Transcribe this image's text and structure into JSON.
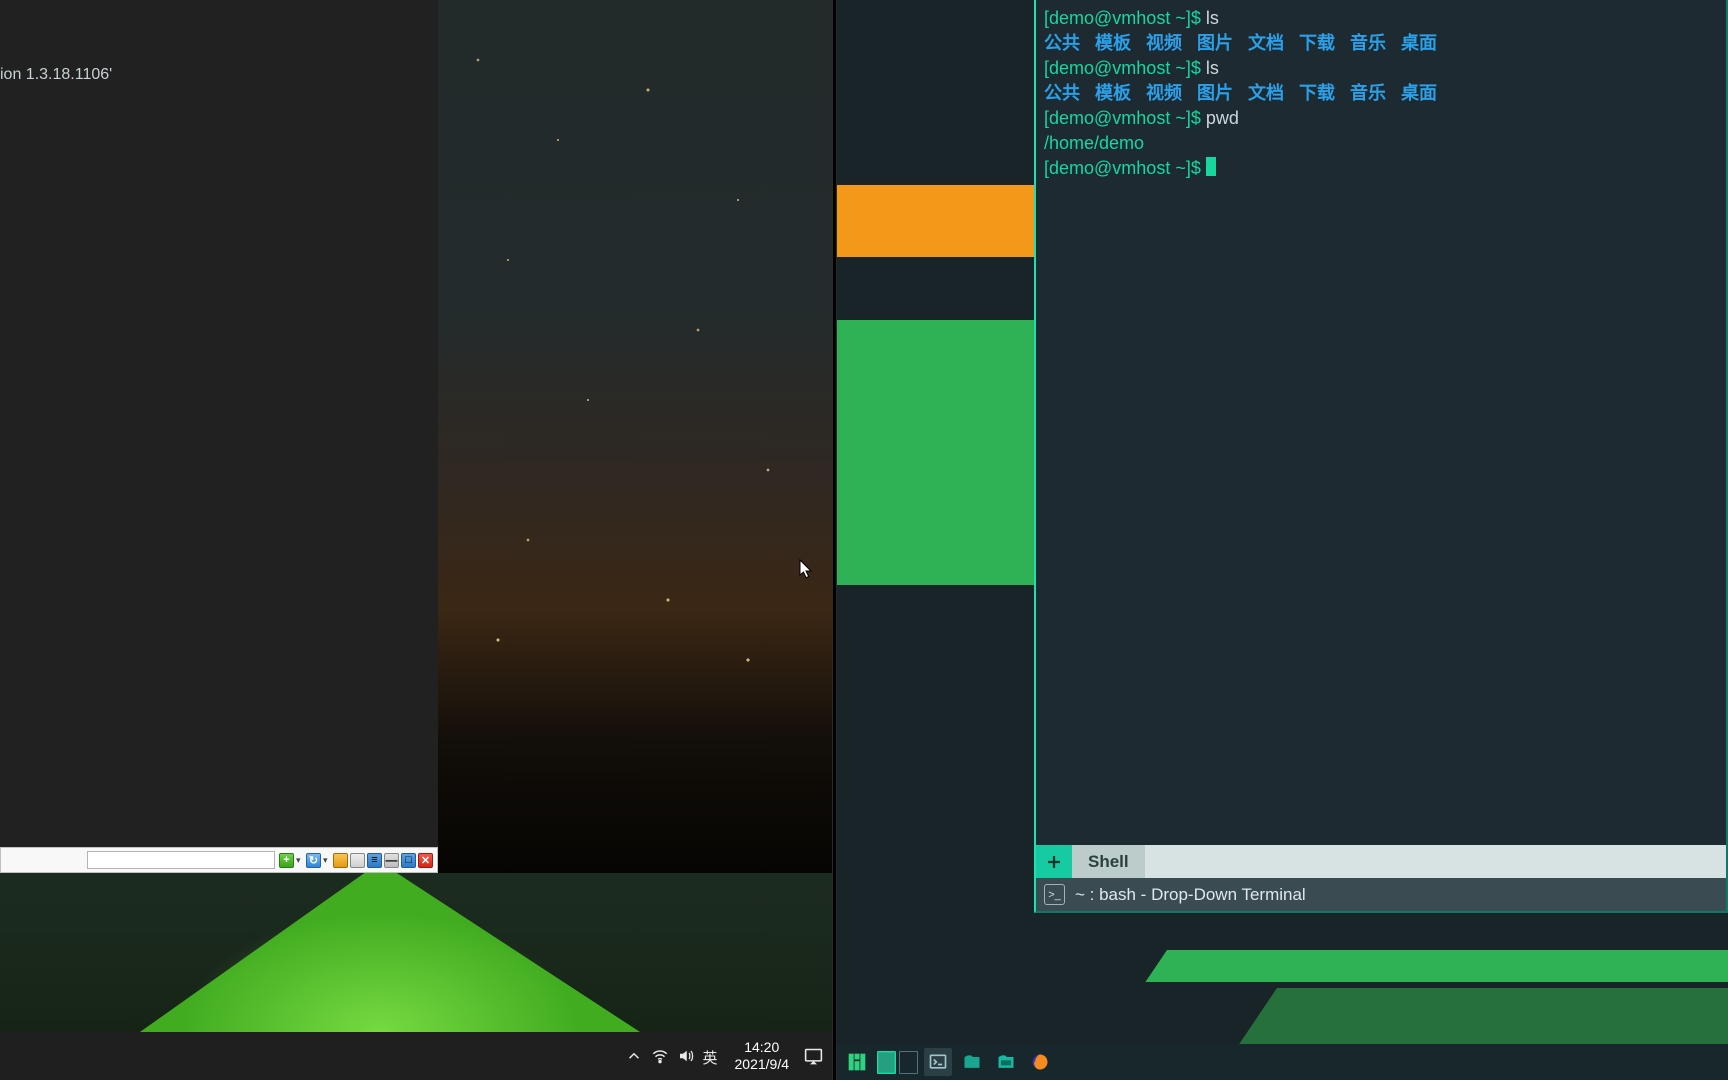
{
  "left_terminal": {
    "fragment": "ion 1.3.18.1106'"
  },
  "vnc_toolbar": {
    "icons": {
      "plus": "+",
      "refresh": "↻",
      "lock": "🔒",
      "screen": "▭",
      "list": "≡",
      "min": "—",
      "max": "□",
      "close": "✕"
    }
  },
  "windows_taskbar": {
    "ime": "英",
    "time": "14:20",
    "date": "2021/9/4"
  },
  "dropdown_terminal": {
    "prompt": "[demo@vmhost ~]$ ",
    "lines": [
      {
        "cmd": "ls"
      },
      {
        "dirs": [
          "公共",
          "模板",
          "视频",
          "图片",
          "文档",
          "下载",
          "音乐",
          "桌面"
        ]
      },
      {
        "cmd": "ls"
      },
      {
        "dirs": [
          "公共",
          "模板",
          "视频",
          "图片",
          "文档",
          "下载",
          "音乐",
          "桌面"
        ]
      },
      {
        "cmd": "pwd"
      },
      {
        "out": "/home/demo"
      },
      {
        "cmd": ""
      }
    ],
    "tab_label": "Shell",
    "title": "~ : bash - Drop-Down Terminal"
  }
}
